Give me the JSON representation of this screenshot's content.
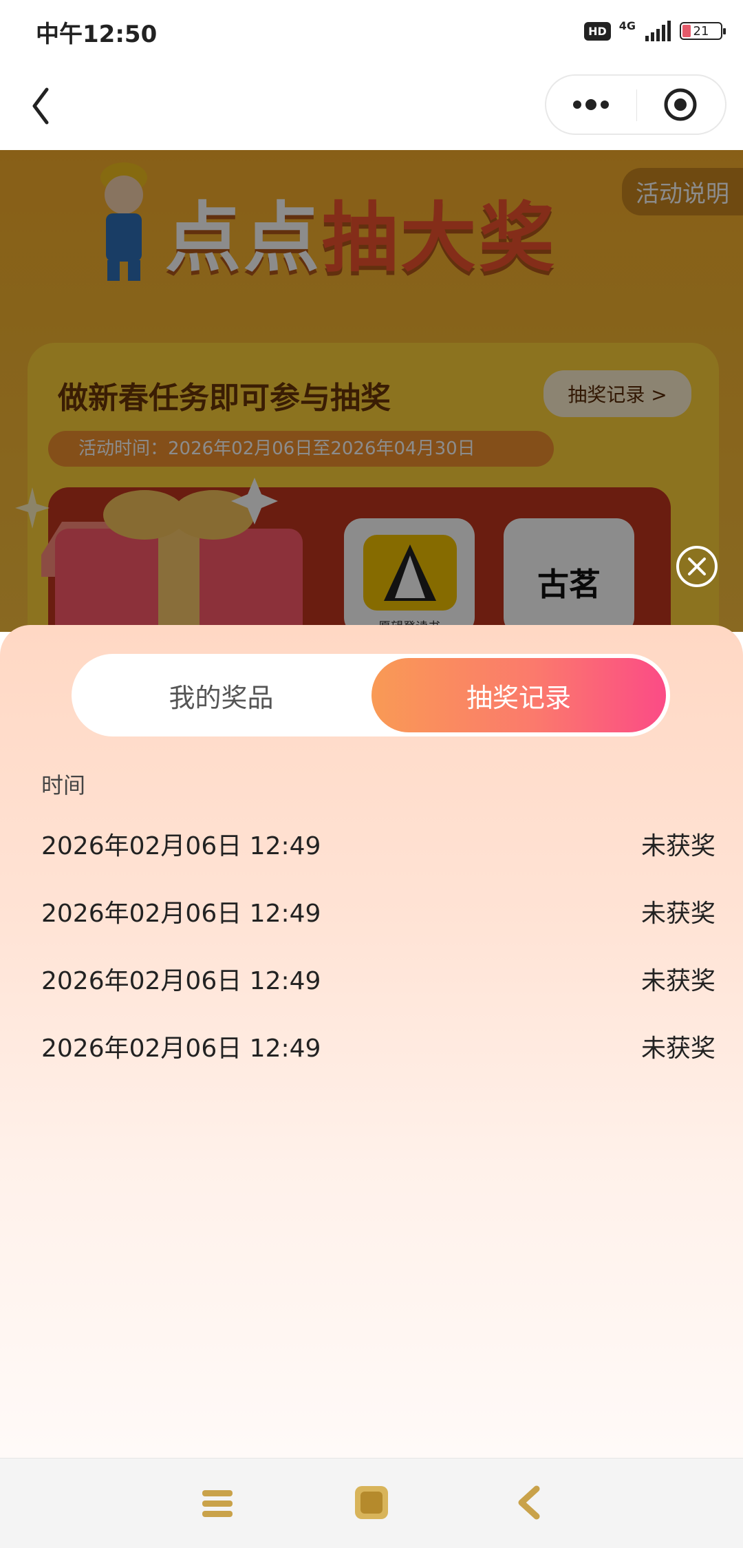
{
  "status_bar": {
    "time": "中午12:50",
    "hd": "HD",
    "network": "4G",
    "battery": "21",
    "battery_level": 0.21
  },
  "nav_bar": {
    "back_icon": "chevron-left-icon",
    "more_icon": "more-dots-icon",
    "close_icon": "target-icon"
  },
  "background_page": {
    "title_part1": "点点",
    "title_part2": "抽大奖",
    "explain_button": "活动说明",
    "card_title": "做新春任务即可参与抽奖",
    "record_button": "抽奖记录 >",
    "activity_time": "活动时间：2026年02月06日至2026年04月30日",
    "prize_book_label": "愿望登读书",
    "prize_brand": "古茗"
  },
  "sheet": {
    "tabs": [
      {
        "label": "我的奖品",
        "active": false
      },
      {
        "label": "抽奖记录",
        "active": true
      }
    ],
    "column_header": "时间",
    "records": [
      {
        "time": "2026年02月06日 12:49",
        "result": "未获奖"
      },
      {
        "time": "2026年02月06日 12:49",
        "result": "未获奖"
      },
      {
        "time": "2026年02月06日 12:49",
        "result": "未获奖"
      },
      {
        "time": "2026年02月06日 12:49",
        "result": "未获奖"
      }
    ]
  },
  "system_nav": {
    "menu_icon": "menu-icon",
    "home_icon": "home-icon",
    "back_icon": "back-icon"
  },
  "colors": {
    "tab_gradient_start": "#f99a55",
    "tab_gradient_end": "#fb4b86",
    "sheet_top": "#ffd8c4"
  }
}
